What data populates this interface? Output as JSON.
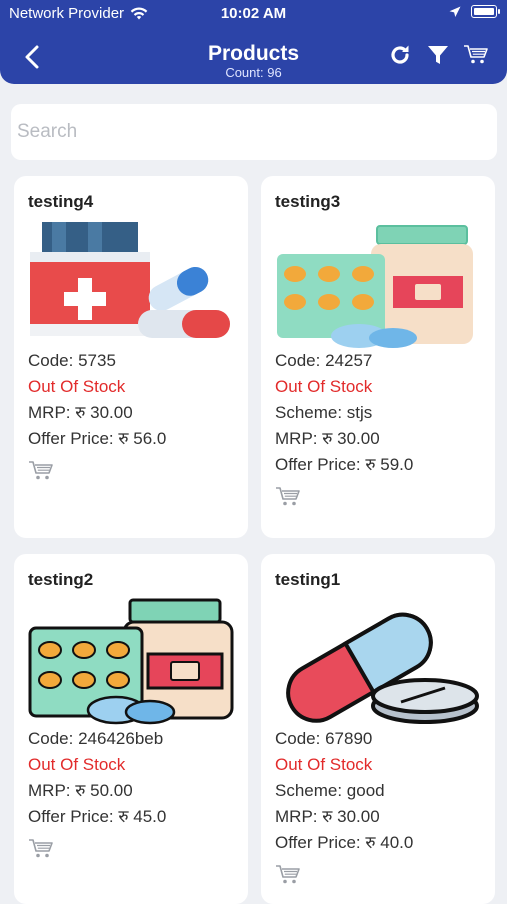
{
  "status_bar": {
    "carrier": "Network Provider",
    "time": "10:02 AM"
  },
  "header": {
    "title": "Products",
    "count": "Count: 96"
  },
  "search": {
    "placeholder": "Search"
  },
  "products": [
    {
      "name": "testing4",
      "code": "Code: 5735",
      "stock": "Out Of Stock",
      "mrp": "MRP: रु 30.00",
      "offer": "Offer Price: रु 56.0"
    },
    {
      "name": "testing3",
      "code": "Code: 24257",
      "stock": "Out Of Stock",
      "scheme": "Scheme: stjs",
      "mrp": "MRP: रु 30.00",
      "offer": "Offer Price: रु 59.0"
    },
    {
      "name": "testing2",
      "code": "Code: 246426beb",
      "stock": "Out Of Stock",
      "mrp": "MRP: रु 50.00",
      "offer": "Offer Price: रु 45.0"
    },
    {
      "name": "testing1",
      "code": "Code: 67890",
      "stock": "Out Of Stock",
      "scheme": "Scheme: good",
      "mrp": "MRP: रु 30.00",
      "offer": "Offer Price: रु 40.0"
    }
  ],
  "colors": {
    "header": "#2c44a8",
    "out_of_stock": "#e22b2b"
  }
}
